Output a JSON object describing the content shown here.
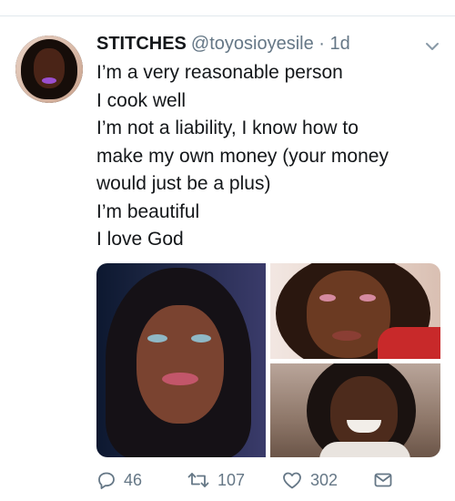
{
  "tweet": {
    "display_name": "STITCHES",
    "handle": "@toyosioyesile",
    "separator": "·",
    "time": "1d",
    "lines": [
      "I’m a very reasonable person",
      "I cook well",
      "I’m not a liability, I know how to",
      "make my own money (your money",
      "would just be a plus)",
      "I’m beautiful",
      "I love God"
    ]
  },
  "actions": {
    "replies": "46",
    "retweets": "107",
    "likes": "302"
  },
  "icons": {
    "menu": "chevron-down-icon",
    "reply": "reply-icon",
    "retweet": "retweet-icon",
    "like": "heart-icon",
    "dm": "envelope-icon"
  },
  "colors": {
    "text": "#14171a",
    "secondary": "#657786",
    "divider": "#e1e8ed"
  }
}
